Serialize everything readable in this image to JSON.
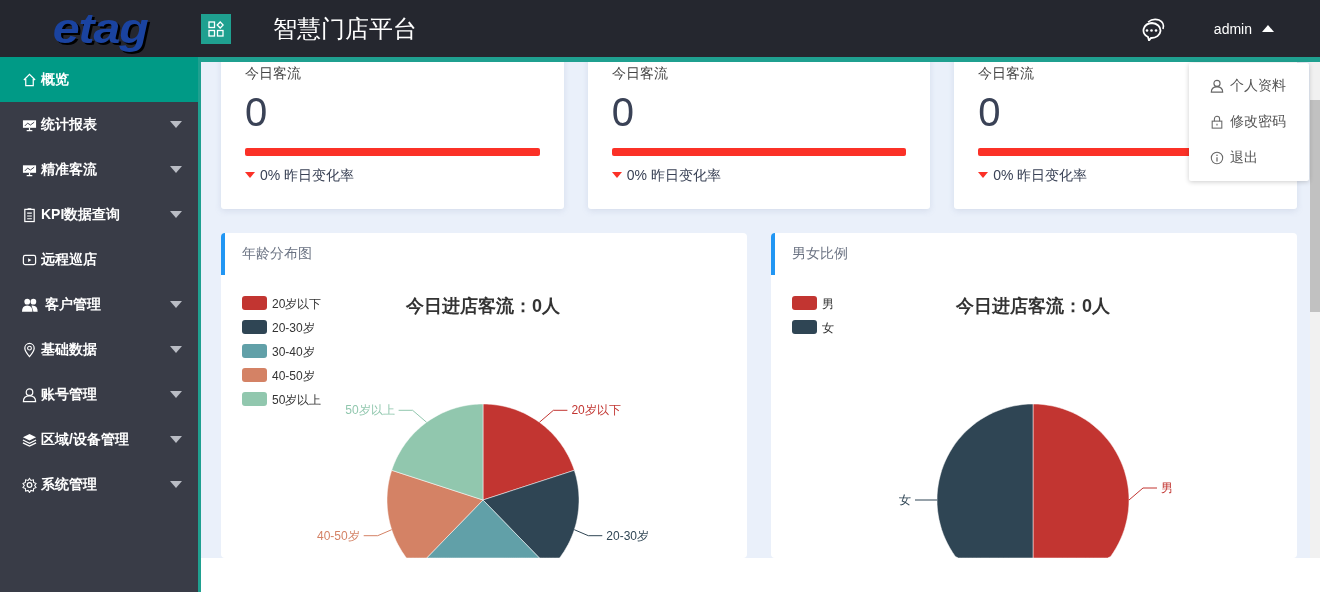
{
  "header": {
    "logo": "etag",
    "title": "智慧门店平台",
    "user": "admin",
    "user_menu_expanded": true
  },
  "user_menu": [
    {
      "kind": "user",
      "label": "个人资料"
    },
    {
      "kind": "lock",
      "label": "修改密码"
    },
    {
      "kind": "info",
      "label": "退出"
    }
  ],
  "sidebar": {
    "items": [
      {
        "kind": "home",
        "label": "概览",
        "selected": true,
        "has_submenu": false
      },
      {
        "kind": "board",
        "label": "统计报表",
        "selected": false,
        "has_submenu": true
      },
      {
        "kind": "board",
        "label": "精准客流",
        "selected": false,
        "has_submenu": true
      },
      {
        "kind": "clipboard",
        "label": "KPI数据查询",
        "selected": false,
        "has_submenu": true
      },
      {
        "kind": "video",
        "label": "远程巡店",
        "selected": false,
        "has_submenu": false
      },
      {
        "kind": "users",
        "label": "客户管理",
        "selected": false,
        "has_submenu": true
      },
      {
        "kind": "pin",
        "label": "基础数据",
        "selected": false,
        "has_submenu": true
      },
      {
        "kind": "user",
        "label": "账号管理",
        "selected": false,
        "has_submenu": true
      },
      {
        "kind": "layers",
        "label": "区域/设备管理",
        "selected": false,
        "has_submenu": true
      },
      {
        "kind": "gear",
        "label": "系统管理",
        "selected": false,
        "has_submenu": true
      }
    ]
  },
  "stat_cards": [
    {
      "label": "今日客流",
      "value": "0",
      "level": 1,
      "kind": "down",
      "change": "0% 昨日变化率"
    },
    {
      "label": "今日客流",
      "value": "0",
      "level": 1,
      "kind": "down",
      "change": "0% 昨日变化率"
    },
    {
      "label": "今日客流",
      "value": "0",
      "level": 1,
      "kind": "down",
      "change": "0% 昨日变化率"
    }
  ],
  "charts": [
    {
      "title": "年龄分布图",
      "chart_title": "今日进店客流：0人",
      "kind": "picture",
      "legend": [
        {
          "label": "20岁以下",
          "color": "#c23531"
        },
        {
          "label": "20-30岁",
          "color": "#2f4554"
        },
        {
          "label": "30-40岁",
          "color": "#61a0a8"
        },
        {
          "label": "40-50岁",
          "color": "#d48265"
        },
        {
          "label": "50岁以上",
          "color": "#91c7ae"
        }
      ],
      "slices": [
        {
          "label": "20岁以下",
          "color": "#c23531"
        },
        {
          "label": "20-30岁",
          "color": "#2f4554"
        },
        {
          "color": "#61a0a8"
        },
        {
          "label": "40-50岁",
          "color": "#d48265"
        },
        {
          "label": "50岁以上",
          "color": "#91c7ae"
        }
      ]
    },
    {
      "title": "男女比例",
      "chart_title": "今日进店客流：0人",
      "kind": "picture",
      "legend": [
        {
          "label": "男",
          "color": "#c23531"
        },
        {
          "label": "女",
          "color": "#2f4554"
        }
      ],
      "slices": [
        {
          "label": "男",
          "color": "#c23531"
        },
        {
          "label": "女",
          "color": "#2f4554"
        }
      ]
    }
  ]
}
